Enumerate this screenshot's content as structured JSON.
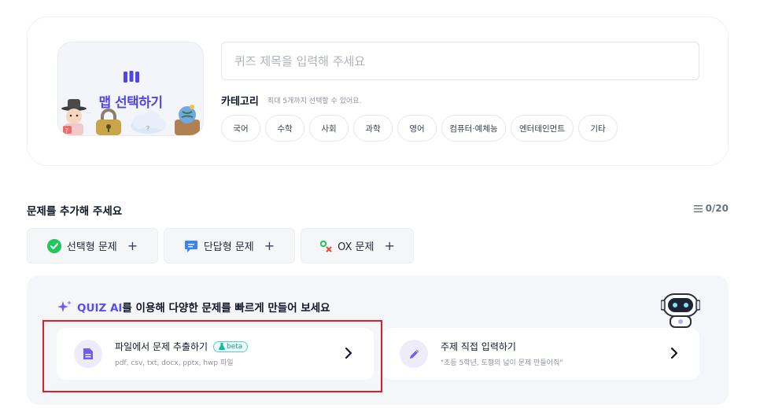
{
  "header_card": {
    "map_button_label": "맵 선택하기",
    "title_input": {
      "value": "",
      "placeholder": "퀴즈 제목을 입력해 주세요"
    },
    "category_label": "카테고리",
    "category_hint": "최대 5개까지 선택할 수 있어요.",
    "categories": [
      "국어",
      "수학",
      "사회",
      "과학",
      "영어",
      "컴퓨터·예체능",
      "엔터테인먼트",
      "기타"
    ]
  },
  "questions": {
    "title": "문제를 추가해 주세요",
    "counter": "0/20",
    "add_buttons": [
      {
        "label": "선택형 문제",
        "icon": "check-circle-icon"
      },
      {
        "label": "단답형 문제",
        "icon": "chat-icon"
      },
      {
        "label": "OX 문제",
        "icon": "ox-icon"
      }
    ],
    "plus": "+"
  },
  "ai": {
    "brand": "QUIZ AI",
    "headline_rest": "를 이용해 다양한 문제를 빠르게 만들어 보세요",
    "options": [
      {
        "title": "파일에서 문제 추출하기",
        "badge": "beta",
        "subtitle": "pdf, csv, txt, docx, pptx, hwp 파일"
      },
      {
        "title": "주제 직접 입력하기",
        "subtitle": "\"초등 5학년, 도형의 넓이 문제 만들어줘\""
      }
    ]
  },
  "colors": {
    "accent": "#4f46e5",
    "highlight": "#e11d2b",
    "check_green": "#22c55e",
    "chat_blue": "#3b82f6"
  }
}
